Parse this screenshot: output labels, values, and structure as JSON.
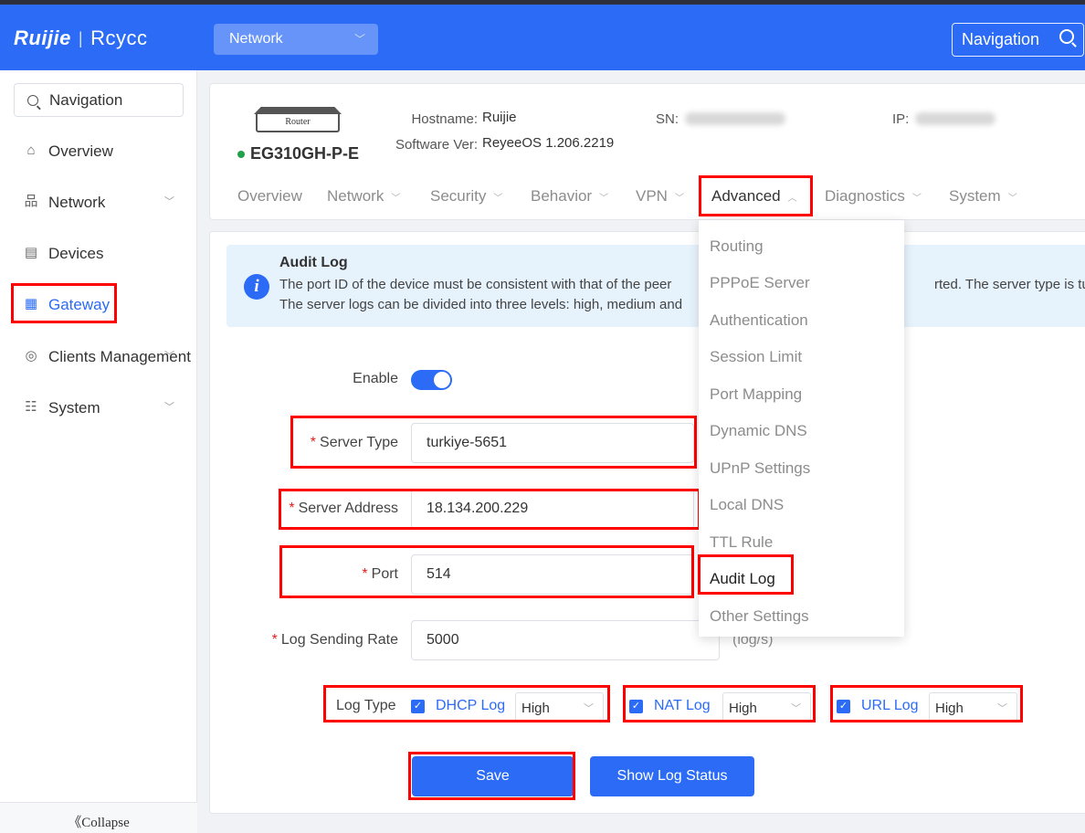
{
  "header": {
    "brand": "Ruijie",
    "sub_brand": "Rcycc",
    "network_select": "Network",
    "navigation_button": "Navigation"
  },
  "sidebar": {
    "search_placeholder": "Navigation",
    "items": [
      {
        "label": "Overview",
        "icon": "home-icon",
        "expandable": false
      },
      {
        "label": "Network",
        "icon": "network-topology-icon",
        "expandable": true
      },
      {
        "label": "Devices",
        "icon": "devices-icon",
        "expandable": false
      },
      {
        "label": "Gateway",
        "icon": "gateway-icon",
        "expandable": false,
        "active": true
      },
      {
        "label": "Clients Management",
        "icon": "user-circle-icon",
        "expandable": true
      },
      {
        "label": "System",
        "icon": "system-settings-icon",
        "expandable": true
      }
    ],
    "collapse_label": "《Collapse"
  },
  "device": {
    "image_label": "Router",
    "model": "EG310GH-P-E",
    "status_color": "#22a04b",
    "hostname_label": "Hostname:",
    "hostname": "Ruijie",
    "software_label": "Software Ver:",
    "software": "ReyeeOS 1.206.2219",
    "sn_label": "SN:",
    "ip_label": "IP:",
    "tabs": [
      {
        "label": "Overview",
        "dropdown": false
      },
      {
        "label": "Network",
        "dropdown": true
      },
      {
        "label": "Security",
        "dropdown": true
      },
      {
        "label": "Behavior",
        "dropdown": true
      },
      {
        "label": "VPN",
        "dropdown": true
      },
      {
        "label": "Advanced",
        "dropdown": true,
        "active": true
      },
      {
        "label": "Diagnostics",
        "dropdown": true
      },
      {
        "label": "System",
        "dropdown": true
      }
    ]
  },
  "advanced_menu": {
    "items": [
      "Routing",
      "PPPoE Server",
      "Authentication",
      "Session Limit",
      "Port Mapping",
      "Dynamic DNS",
      "UPnP Settings",
      "Local DNS",
      "TTL Rule",
      "Audit Log",
      "Other Settings"
    ],
    "active": "Audit Log"
  },
  "alert": {
    "title": "Audit Log",
    "line1_left": "The port ID of the device must be consistent with that of the peer",
    "line1_right": "rted. The server type is turkiy",
    "line2": "The server logs can be divided into three levels: high, medium and"
  },
  "form": {
    "enable_label": "Enable",
    "enabled": true,
    "server_type_label": "Server Type",
    "server_type": "turkiye-5651",
    "server_address_label": "Server Address",
    "server_address": "18.134.200.229",
    "port_label": "Port",
    "port": "514",
    "rate_label": "Log Sending Rate",
    "rate": "5000",
    "rate_unit": "(log/s)",
    "log_type_label": "Log Type",
    "log_types": [
      {
        "label": "DHCP Log",
        "checked": true,
        "level": "High"
      },
      {
        "label": "NAT Log",
        "checked": true,
        "level": "High"
      },
      {
        "label": "URL Log",
        "checked": true,
        "level": "High"
      }
    ],
    "required_mark": "*"
  },
  "buttons": {
    "save": "Save",
    "show_log_status": "Show Log Status"
  },
  "colors": {
    "primary": "#2b6bf6",
    "highlight": "#ff0000",
    "alert_bg": "#e6f2fc"
  }
}
